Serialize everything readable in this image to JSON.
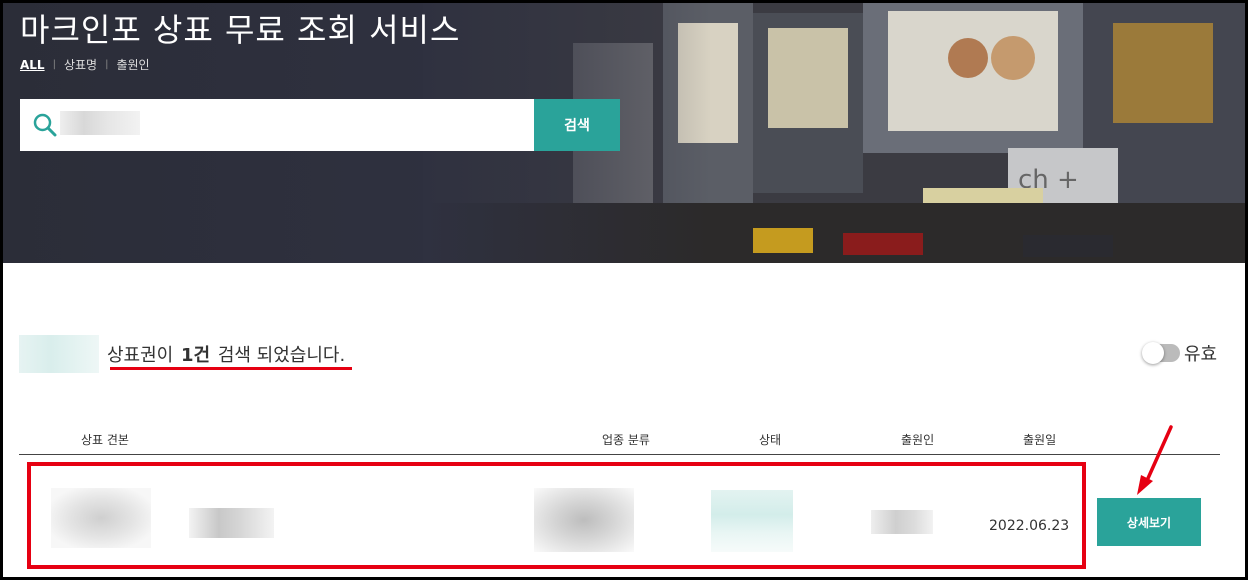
{
  "hero": {
    "title": "마크인포 상표 무료 조회 서비스",
    "filters": [
      "ALL",
      "상표명",
      "출원인"
    ],
    "search": {
      "value": "",
      "placeholder": "",
      "button_label": "검색"
    }
  },
  "summary": {
    "prefix": "상표권이",
    "count": "1건",
    "suffix": "검색 되었습니다.",
    "toggle_label": "유효"
  },
  "table": {
    "headers": [
      "상표 견본",
      "업종 분류",
      "상태",
      "출원인",
      "출원일"
    ],
    "rows": [
      {
        "date": "2022.06.23",
        "action": "상세보기"
      }
    ]
  },
  "colors": {
    "accent": "#2aa39a",
    "highlight": "#e60012"
  },
  "icons": {
    "search": "search-icon",
    "arrow": "red-arrow-icon"
  }
}
